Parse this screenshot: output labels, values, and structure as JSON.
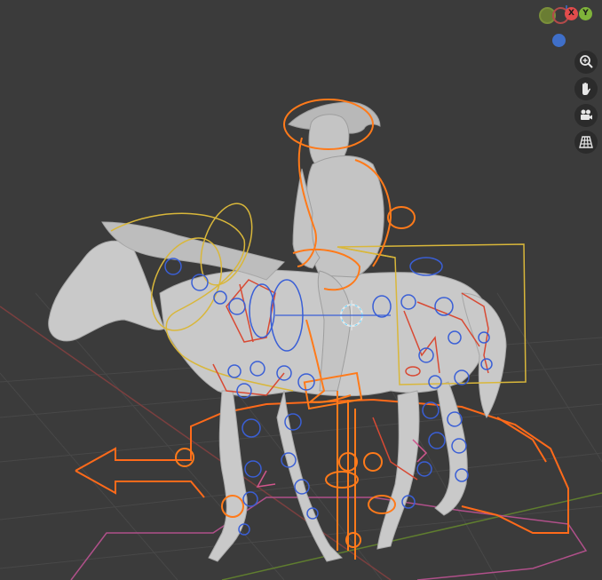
{
  "viewport": {
    "background": "#3b3b3b",
    "grid_color": "#494949",
    "x_axis_color": "#7a3f3f",
    "y_axis_color": "#5f7d2f"
  },
  "gizmo": {
    "y_neg_color": "#7a8f3a",
    "x_neg_color": "#b34a4a",
    "x_label": "X",
    "x_color": "#e24c4c",
    "y_label": "Y",
    "y_color": "#7fb33a",
    "z_color": "#3f6fc9"
  },
  "toolbar": {
    "items": [
      {
        "name": "zoom",
        "icon": "magnifier-plus-icon"
      },
      {
        "name": "pan",
        "icon": "hand-icon"
      },
      {
        "name": "camera",
        "icon": "camera-icon"
      },
      {
        "name": "perspective",
        "icon": "grid-icon"
      }
    ]
  },
  "rig": {
    "model_color": "#c9c9c9",
    "bone_selected_color": "#ff7a1a",
    "bone_active_color": "#d9b73a",
    "bone_ik_color": "#3a5fd6",
    "bone_fk_color": "#e04a3a"
  }
}
